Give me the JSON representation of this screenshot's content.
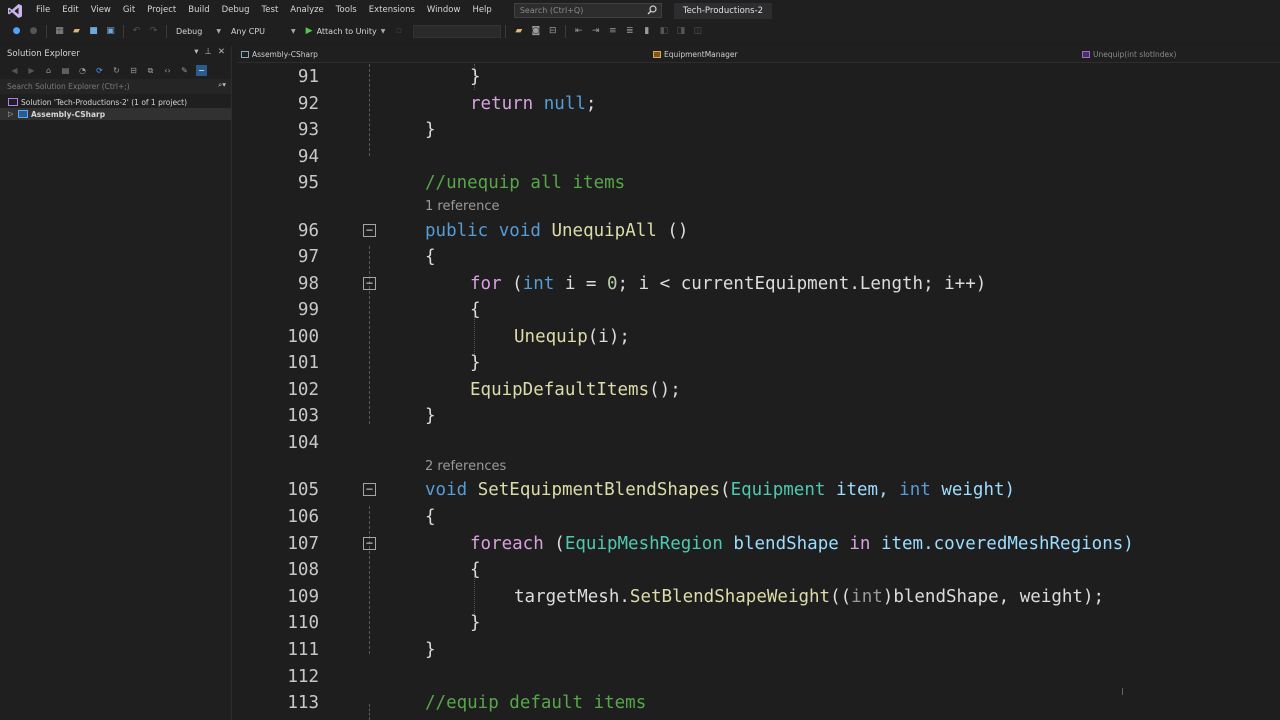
{
  "menubar": {
    "items": [
      "File",
      "Edit",
      "View",
      "Git",
      "Project",
      "Build",
      "Debug",
      "Test",
      "Analyze",
      "Tools",
      "Extensions",
      "Window",
      "Help"
    ],
    "search_placeholder": "Search (Ctrl+Q)",
    "window_title": "Tech-Productions-2"
  },
  "toolbar": {
    "configuration": "Debug",
    "platform": "Any CPU",
    "attach_label": "Attach to Unity"
  },
  "solution_explorer": {
    "title": "Solution Explorer",
    "search_placeholder": "Search Solution Explorer (Ctrl+;)",
    "solution_label": "Solution 'Tech-Productions-2' (1 of 1 project)",
    "project_label": "Assembly-CSharp"
  },
  "navbar": {
    "project": "Assembly-CSharp",
    "class": "EquipmentManager",
    "member": "Unequip(int slotIndex)"
  },
  "codelens": {
    "ref_unequip_all": "1 reference",
    "ref_set_blend": "2 references"
  },
  "code": {
    "lines": [
      {
        "n": "91"
      },
      {
        "n": "92"
      },
      {
        "n": "93"
      },
      {
        "n": "94"
      },
      {
        "n": "95"
      },
      {
        "n": "96"
      },
      {
        "n": "97"
      },
      {
        "n": "98"
      },
      {
        "n": "99"
      },
      {
        "n": "100"
      },
      {
        "n": "101"
      },
      {
        "n": "102"
      },
      {
        "n": "103"
      },
      {
        "n": "104"
      },
      {
        "n": "105"
      },
      {
        "n": "106"
      },
      {
        "n": "107"
      },
      {
        "n": "108"
      },
      {
        "n": "109"
      },
      {
        "n": "110"
      },
      {
        "n": "111"
      },
      {
        "n": "112"
      },
      {
        "n": "113"
      }
    ],
    "tokens": {
      "l91_brace": "}",
      "l92_return": "return",
      "l92_null": "null",
      "l92_semi": ";",
      "l93_brace": "}",
      "l95_comment": "//unequip all items",
      "l96_public": "public",
      "l96_void": "void",
      "l96_name": "UnequipAll",
      "l96_parens": " ()",
      "l97_brace": "{",
      "l98_for": "for",
      "l98_open": " (",
      "l98_int": "int",
      "l98_i1": " i = ",
      "l98_zero": "0",
      "l98_rest": "; i < currentEquipment.Length; i++)",
      "l99_brace": "{",
      "l100_call": "Unequip",
      "l100_args": "(i);",
      "l101_brace": "}",
      "l102_call": "EquipDefaultItems",
      "l102_args": "();",
      "l103_brace": "}",
      "l105_void": "void",
      "l105_name": "SetEquipmentBlendShapes",
      "l105_open": "(",
      "l105_type": "Equipment",
      "l105_item": " item, ",
      "l105_int": "int",
      "l105_weight": " weight)",
      "l106_brace": "{",
      "l107_foreach": "foreach",
      "l107_open": " (",
      "l107_type": "EquipMeshRegion",
      "l107_var": " blendShape ",
      "l107_in": "in",
      "l107_rest": " item.coveredMeshRegions)",
      "l108_brace": "{",
      "l109_obj": "targetMesh.",
      "l109_fn": "SetBlendShapeWeight",
      "l109_open": "((",
      "l109_int": "int",
      "l109_rest": ")blendShape, weight);",
      "l110_brace": "}",
      "l111_brace": "}",
      "l113_comment": "//equip default items"
    }
  },
  "colors": {
    "keyword": "#569cd6",
    "type": "#4ec9b0",
    "method": "#dcdcaa",
    "comment": "#57a64a",
    "control": "#d8a0df",
    "number": "#b5cea8",
    "background": "#1e1e1e"
  }
}
